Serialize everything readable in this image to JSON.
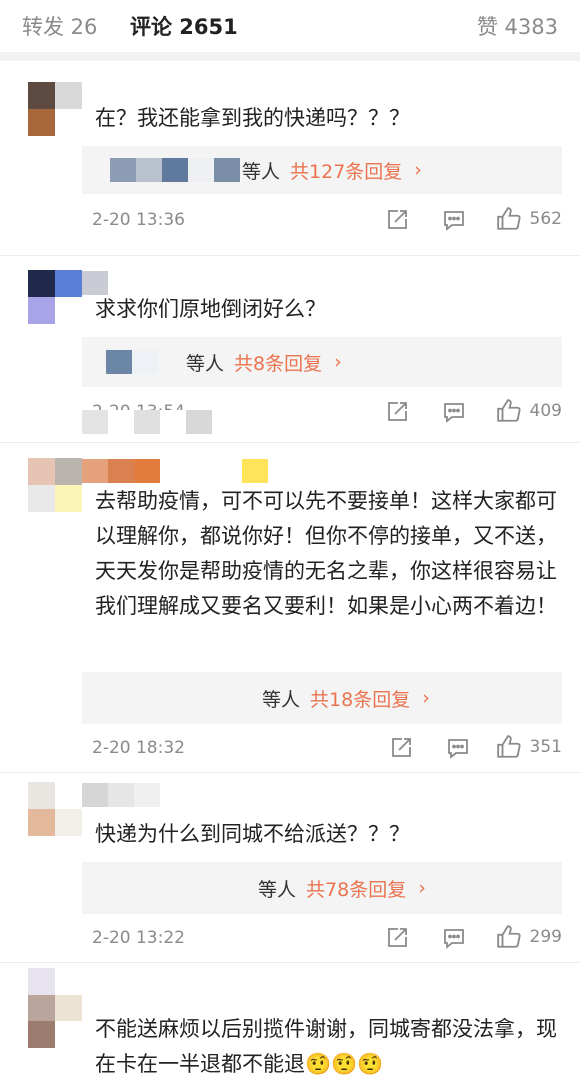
{
  "tabs": {
    "repost": "转发 26",
    "comments": "评论 2651",
    "likes": "赞 4383"
  },
  "comments": [
    {
      "text": "在？我还能拿到我的快递吗？？？",
      "reply_who": "等人",
      "reply_count": "共127条回复",
      "reply_arrow": "›",
      "time": "2-20 13:36",
      "likes": "562"
    },
    {
      "text": "求求你们原地倒闭好么？",
      "reply_who": "等人",
      "reply_count": "共8条回复",
      "reply_arrow": "›",
      "time": "2-20 13:54",
      "likes": "409"
    },
    {
      "text": "去帮助疫情，可不可以先不要接单！这样大家都可以理解你，都说你好！但你不停的接单，又不送，天天发你是帮助疫情的无名之辈，你这样很容易让我们理解成又要名又要利！如果是小心两不着边！",
      "reply_who": "等人",
      "reply_count": "共18条回复",
      "reply_arrow": "›",
      "time": "2-20 18:32",
      "likes": "351"
    },
    {
      "text": "快递为什么到同城不给派送？？？",
      "reply_who": "等人",
      "reply_count": "共78条回复",
      "reply_arrow": "›",
      "time": "2-20 13:22",
      "likes": "299"
    },
    {
      "text": "不能送麻烦以后别揽件谢谢，同城寄都没法拿，现在卡在一半退都不能退🤨🤨🤨"
    }
  ],
  "colors": {
    "accent": "#eb7350",
    "muted": "#8a8a8a",
    "divider": "#f2f2f2"
  },
  "icons": [
    "share-icon",
    "comment-icon",
    "thumb-up-icon",
    "chevron-right-icon"
  ]
}
